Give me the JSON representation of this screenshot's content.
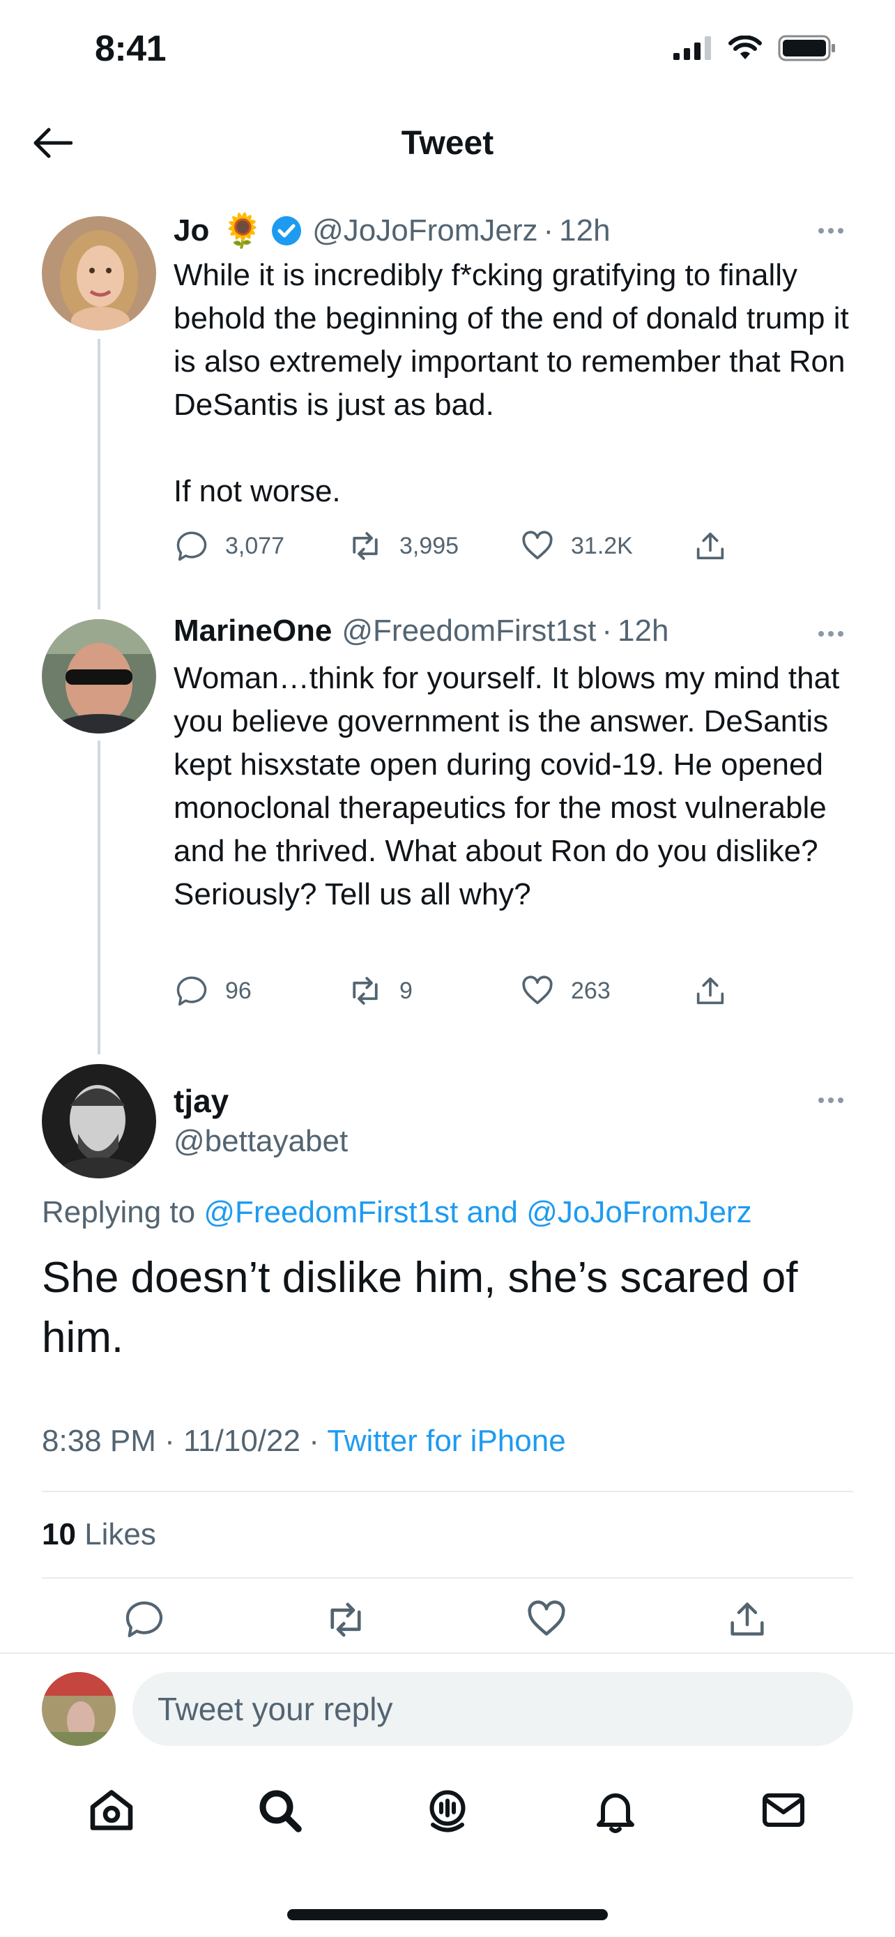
{
  "status_bar": {
    "time": "8:41"
  },
  "header": {
    "title": "Tweet"
  },
  "thread": [
    {
      "name": "Jo",
      "emoji": "🌻",
      "verified": true,
      "handle": "@JoJoFromJerz",
      "time": "12h",
      "text": "While it is incredibly f*cking gratifying to finally behold the beginning of the end of donald trump it is also extremely important to remember that Ron DeSantis is just as bad.\n\nIf not worse.",
      "replies": "3,077",
      "retweets": "3,995",
      "likes": "31.2K"
    },
    {
      "name": "MarineOne",
      "handle": "@FreedomFirst1st",
      "time": "12h",
      "text": "Woman…think for yourself. It blows my mind that you believe government is the answer. DeSantis kept hisxstate open during covid-19. He opened monoclonal therapeutics for the most vulnerable and he thrived. What about Ron do you dislike? Seriously? Tell us all why?",
      "replies": "96",
      "retweets": "9",
      "likes": "263"
    }
  ],
  "main_tweet": {
    "name": "tjay",
    "handle": "@bettayabet",
    "replying_prefix": "Replying to",
    "replying_to": "@FreedomFirst1st and @JoJoFromJerz",
    "text": "She doesn’t dislike him, she’s scared of him.",
    "timestamp": "8:38 PM · 11/10/22 ·",
    "source": "Twitter for iPhone",
    "likes_count": "10",
    "likes_label": "Likes"
  },
  "reply": {
    "placeholder": "Tweet your reply"
  },
  "colors": {
    "accent": "#1d9bf0",
    "muted": "#536471",
    "text": "#0f1419"
  }
}
